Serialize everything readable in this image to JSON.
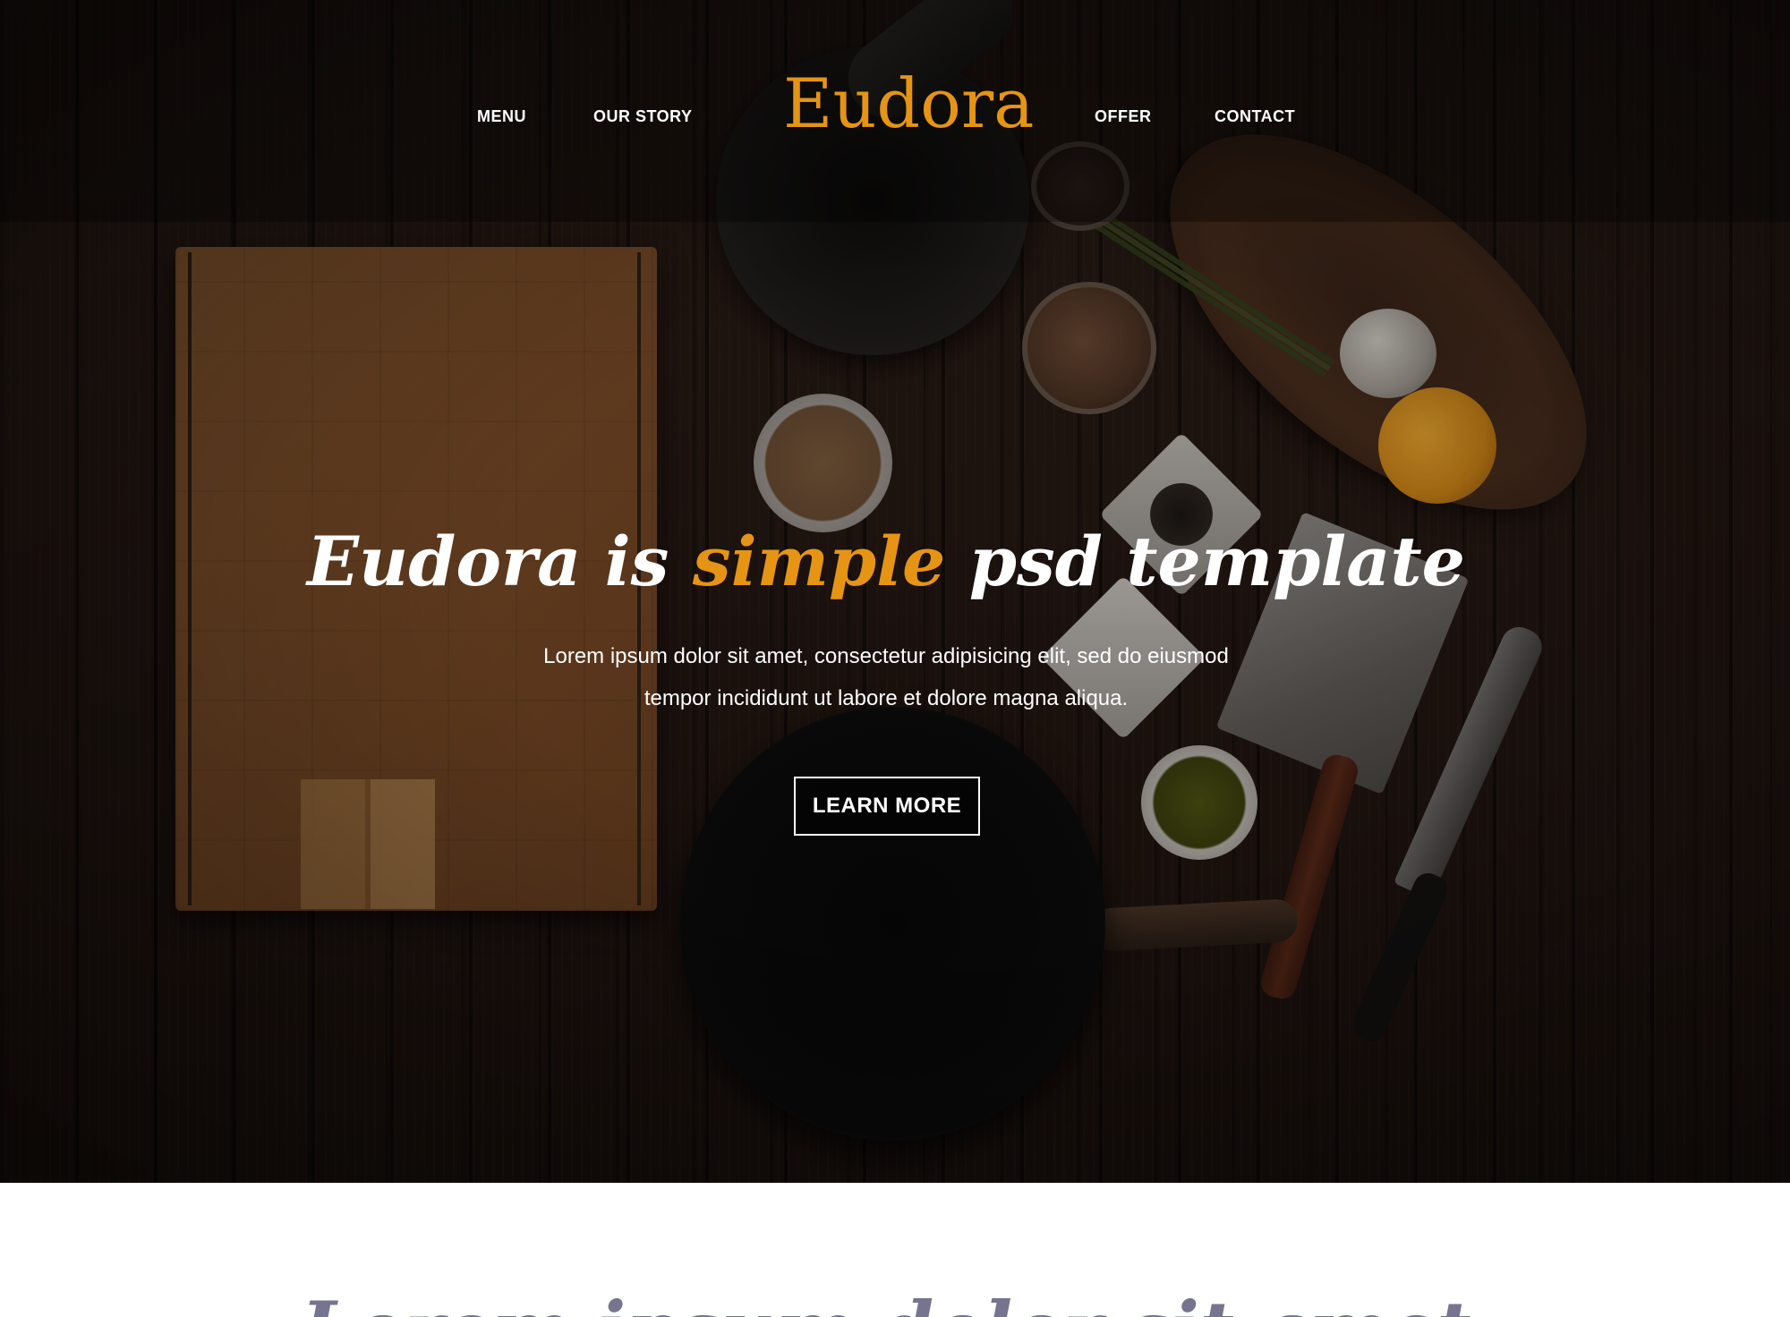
{
  "brand": {
    "logo_text": "Eudora",
    "accent_color": "#e59414"
  },
  "nav": {
    "items": [
      {
        "label": "MENU"
      },
      {
        "label": "OUR STORY"
      },
      {
        "label": "OFFER"
      },
      {
        "label": "CONTACT"
      }
    ]
  },
  "hero": {
    "headline_part1": "Eudora is ",
    "headline_accent": "simple",
    "headline_part2": " psd template",
    "subtext": "Lorem ipsum dolor sit amet, consectetur adipisicing elit, sed do eiusmod tempor incididunt ut labore et dolore magna aliqua.",
    "cta_label": "LEARN MORE"
  },
  "next_section": {
    "heading": "Lorem ipsum dolor sit amet"
  }
}
